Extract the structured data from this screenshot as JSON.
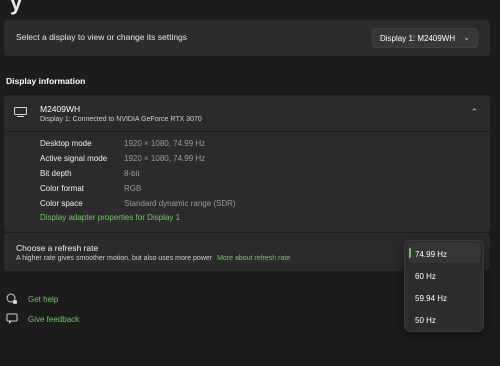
{
  "page": {
    "title_cut": "y"
  },
  "select_display": {
    "label": "Select a display to view or change its settings",
    "dropdown_value": "Display 1: M2409WH"
  },
  "display_information": {
    "heading": "Display information",
    "monitor_name": "M2409WH",
    "monitor_subtitle": "Display 1: Connected to NVIDIA GeForce RTX 3070",
    "rows": [
      {
        "key": "Desktop mode",
        "value": "1920 × 1080, 74.99 Hz"
      },
      {
        "key": "Active signal mode",
        "value": "1920 × 1080, 74.99 Hz"
      },
      {
        "key": "Bit depth",
        "value": "8-bit"
      },
      {
        "key": "Color format",
        "value": "RGB"
      },
      {
        "key": "Color space",
        "value": "Standard dynamic range (SDR)"
      }
    ],
    "adapter_link": "Display adapter properties for Display 1"
  },
  "refresh_rate": {
    "title": "Choose a refresh rate",
    "subtitle": "A higher rate gives smoother motion, but also uses more power",
    "more_link": "More about refresh rate",
    "options": [
      "74.99 Hz",
      "60 Hz",
      "59.94 Hz",
      "50 Hz"
    ],
    "selected": "74.99 Hz"
  },
  "help": {
    "get_help": "Get help",
    "give_feedback": "Give feedback"
  },
  "colors": {
    "background": "#1c1c1c",
    "card": "#2b2b2b",
    "accent": "#6ccb5f"
  },
  "icons": {
    "monitor": "monitor-icon",
    "collapse": "chevron-up-icon",
    "dropdown": "chevron-down-icon",
    "help": "help-icon",
    "feedback": "feedback-icon"
  }
}
